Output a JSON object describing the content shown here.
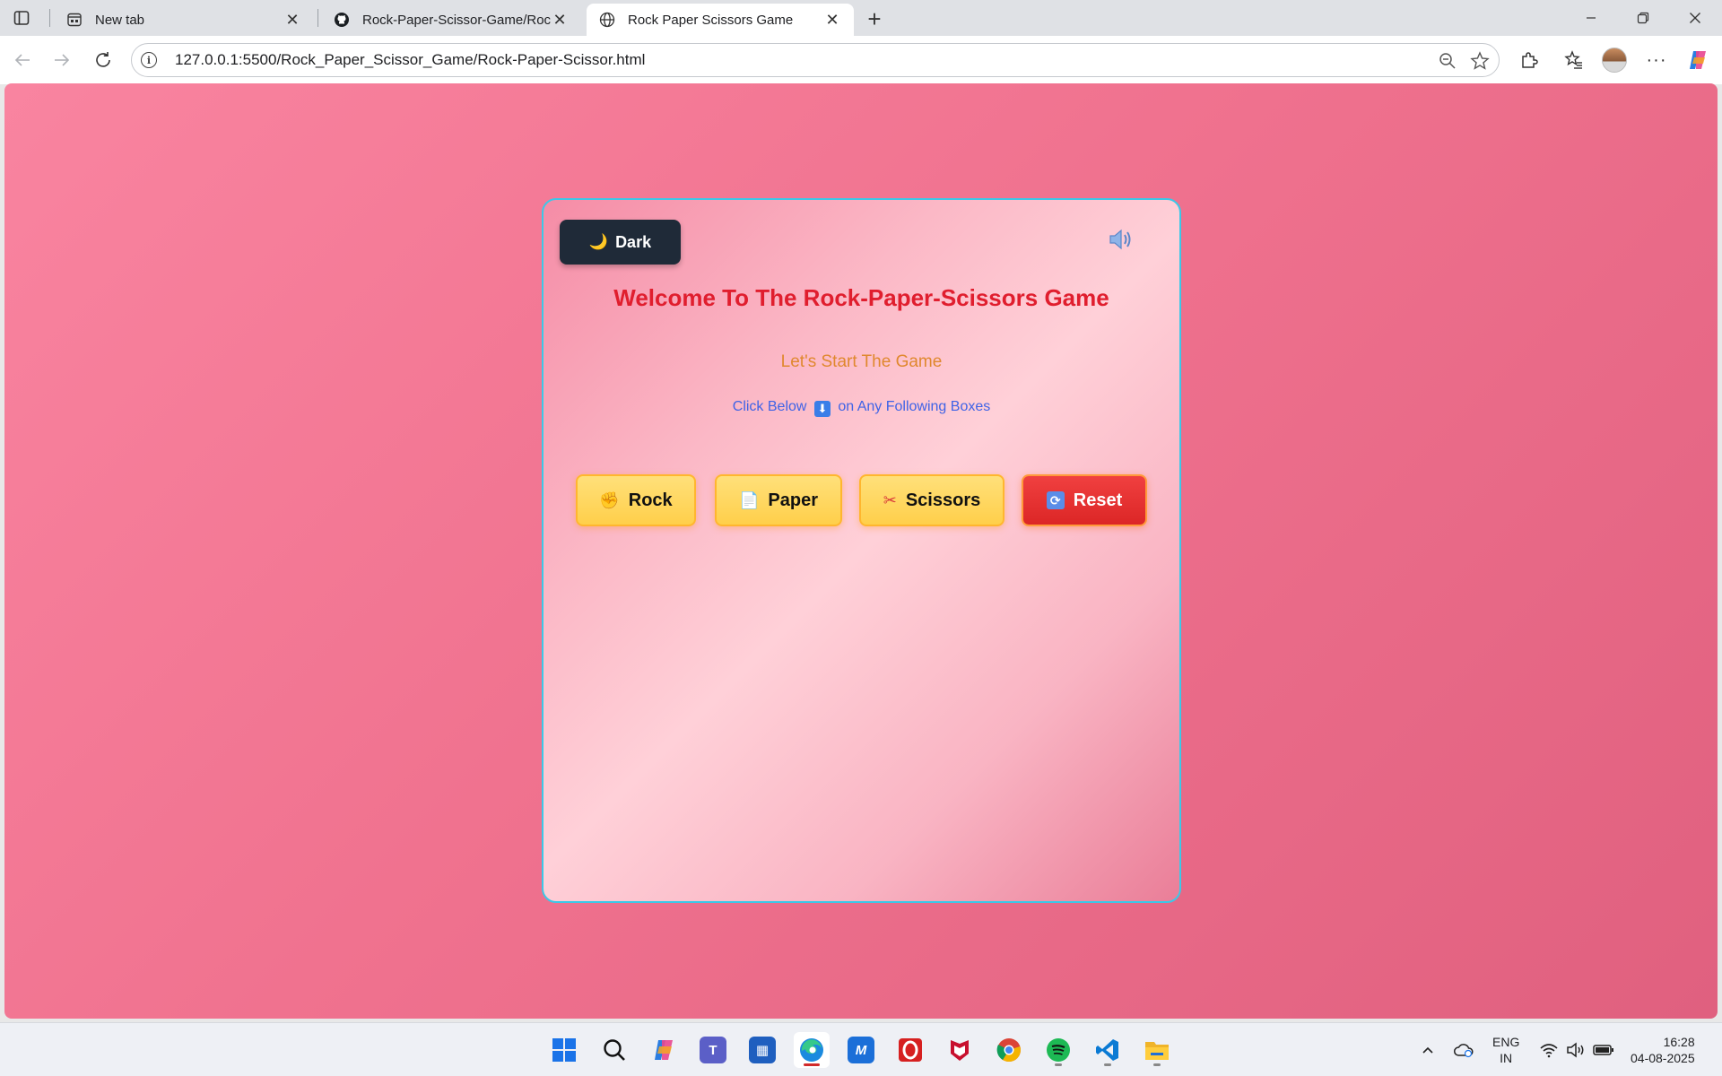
{
  "browser": {
    "tabs": [
      {
        "title": "New tab",
        "icon": "new-tab-page-icon"
      },
      {
        "title": "Rock-Paper-Scissor-Game/Rock-P",
        "icon": "github-icon"
      },
      {
        "title": "Rock Paper Scissors Game",
        "icon": "globe-icon",
        "active": true
      }
    ],
    "url": "127.0.0.1:5500/Rock_Paper_Scissor_Game/Rock-Paper-Scissor.html"
  },
  "game": {
    "dark_label": "Dark",
    "dark_icon": "🌙",
    "title": "Welcome To The Rock-Paper-Scissors Game",
    "subtitle": "Let's Start The Game",
    "instruction_before": "Click Below",
    "instruction_arrow": "⬇",
    "instruction_after": "on Any Following Boxes",
    "buttons": [
      {
        "label": "Rock",
        "icon": "✊"
      },
      {
        "label": "Paper",
        "icon": "📄"
      },
      {
        "label": "Scissors",
        "icon": "✂"
      },
      {
        "label": "Reset",
        "icon": "🔄"
      }
    ],
    "colors": {
      "title": "#e01e2e",
      "subtitle": "#e0882e",
      "instruction": "#3f63e6",
      "border": "#3cc8e8",
      "reset": "#dc2626",
      "choice": "#ffd55a"
    }
  },
  "taskbar": {
    "apps": [
      "windows-start-icon",
      "search-icon",
      "copilot-icon",
      "teams-icon",
      "store-icon",
      "edge-icon",
      "app-icon",
      "opera-icon",
      "mcafee-icon",
      "chrome-icon",
      "spotify-icon",
      "vscode-icon",
      "file-explorer-icon"
    ],
    "lang_line1": "ENG",
    "lang_line2": "IN",
    "time": "16:28",
    "date": "04-08-2025"
  }
}
